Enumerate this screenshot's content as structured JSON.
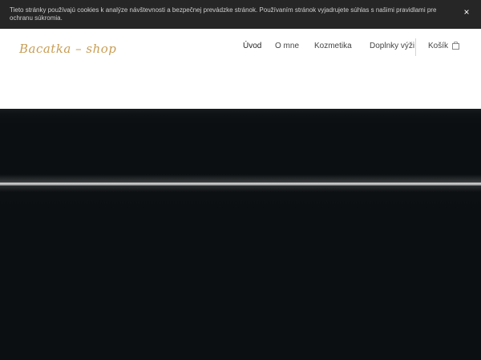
{
  "cookie_bar": {
    "text": "Tieto stránky používajú cookies k analýze návštevnosti a bezpečnej prevádzke stránok. Používaním stránok vyjadrujete súhlas s našimi pravidlami pre ochranu súkromia.",
    "close_symbol": "×"
  },
  "header": {
    "logo_text": "Bacatka – shop",
    "nav": [
      {
        "label": "Úvod"
      },
      {
        "label": "O mne"
      },
      {
        "label": "Kozmetika"
      },
      {
        "label": "Doplnky výži"
      }
    ],
    "cart": {
      "label": "Košík",
      "icon": "shopping-bag-icon"
    }
  },
  "colors": {
    "logo": "#c89d54",
    "cookie_bar": "#262626",
    "hero": "#0b0f12"
  }
}
